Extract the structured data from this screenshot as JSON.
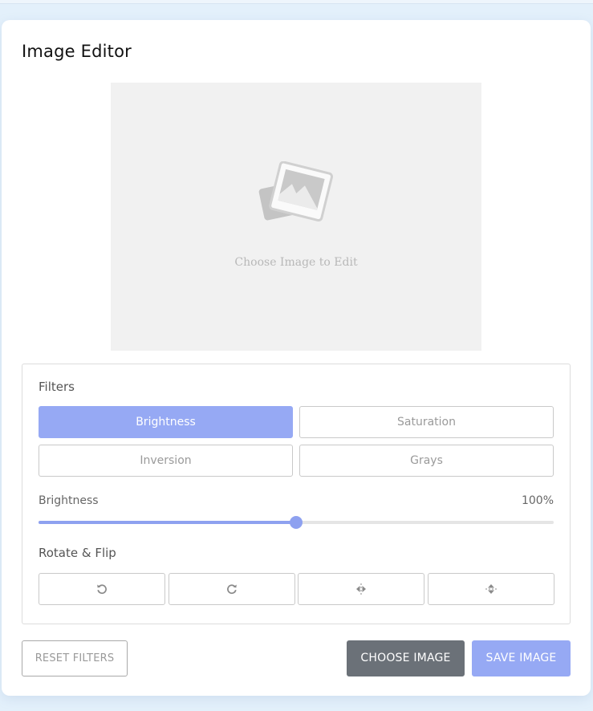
{
  "app": {
    "title": "Image Editor"
  },
  "preview": {
    "placeholder_text": "Choose Image to Edit",
    "icon": "image-placeholder-icon"
  },
  "filters": {
    "label": "Filters",
    "buttons": [
      {
        "label": "Brightness",
        "active": true
      },
      {
        "label": "Saturation",
        "active": false
      },
      {
        "label": "Inversion",
        "active": false
      },
      {
        "label": "Grays",
        "active": false
      }
    ]
  },
  "slider": {
    "name": "Brightness",
    "value_text": "100%",
    "fraction": 0.5
  },
  "rotate_flip": {
    "label": "Rotate & Flip",
    "buttons": [
      {
        "icon": "rotate-left-icon"
      },
      {
        "icon": "rotate-right-icon"
      },
      {
        "icon": "flip-horizontal-icon"
      },
      {
        "icon": "flip-vertical-icon"
      }
    ]
  },
  "actions": {
    "reset": "RESET FILTERS",
    "choose": "CHOOSE IMAGE",
    "save": "SAVE IMAGE"
  },
  "colors": {
    "accent": "#96a9f4",
    "dark_button": "#6b7178",
    "background": "#e3f0fb"
  }
}
